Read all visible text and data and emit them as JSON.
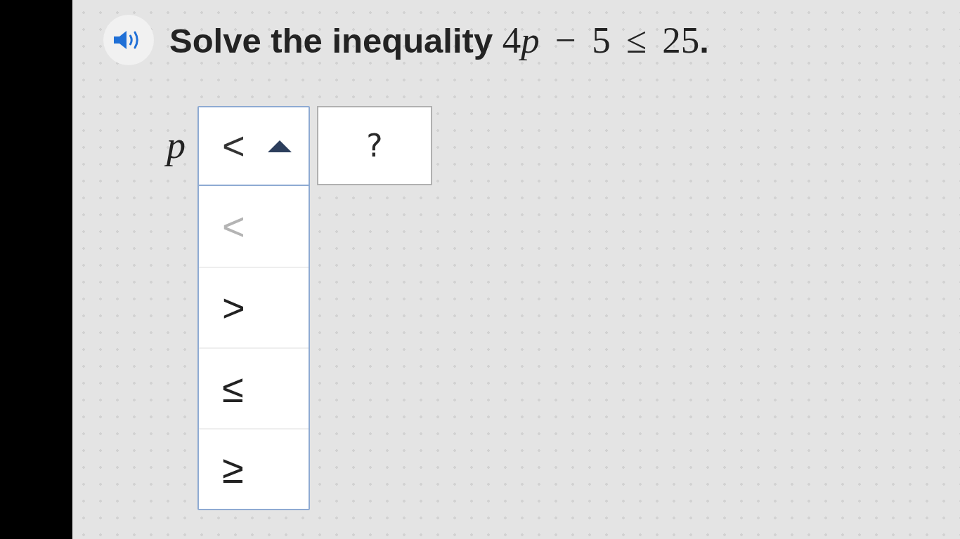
{
  "question": {
    "prompt": "Solve the inequality",
    "expression": [
      {
        "kind": "roman",
        "text": "4"
      },
      {
        "kind": "italic",
        "text": "p"
      },
      {
        "kind": "roman",
        "text": " − 5 ≤ 25"
      },
      {
        "kind": "punctuation",
        "text": "."
      }
    ]
  },
  "answer": {
    "variable": "p",
    "dropdown": {
      "value": "<",
      "expanded": true,
      "options": [
        {
          "label": "<",
          "selected": true
        },
        {
          "label": ">",
          "selected": false
        },
        {
          "label": "≤",
          "selected": false
        },
        {
          "label": "≥",
          "selected": false
        }
      ]
    },
    "answer_box": {
      "placeholder": "?"
    }
  }
}
